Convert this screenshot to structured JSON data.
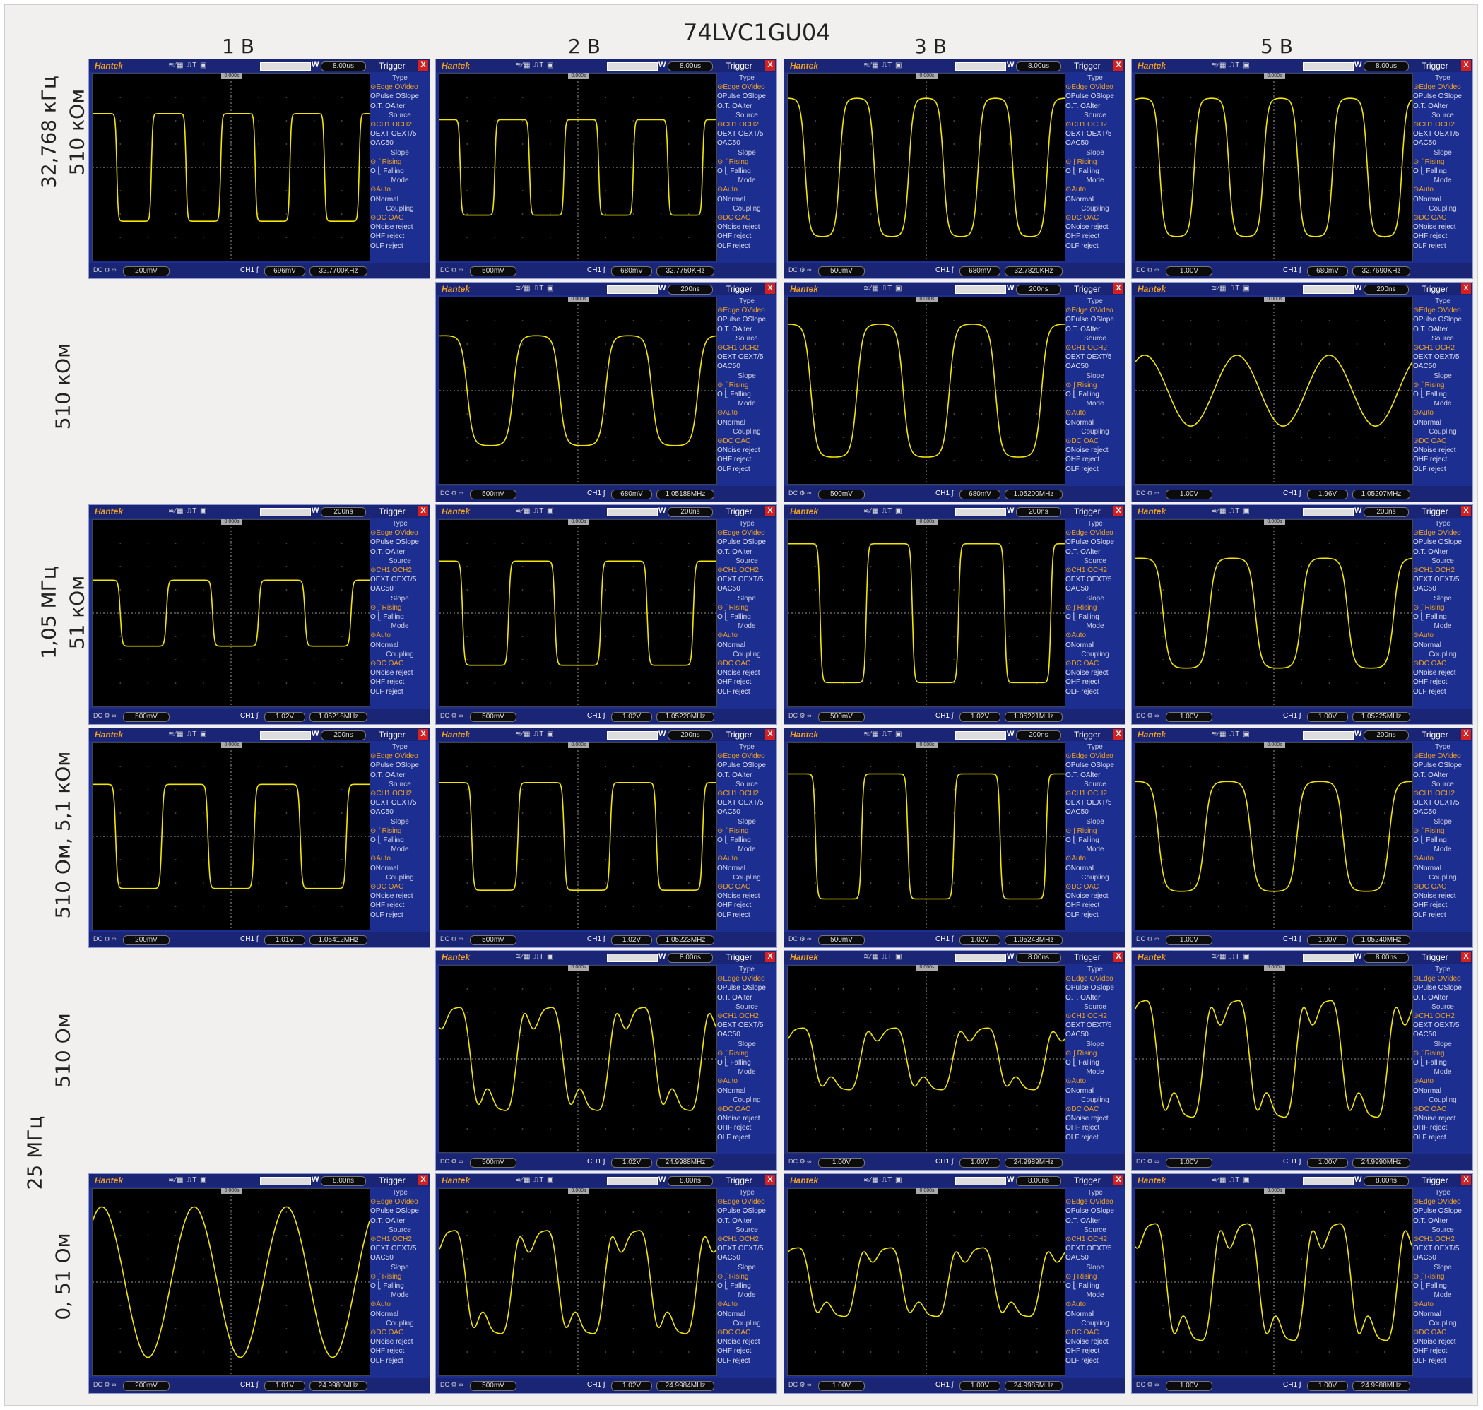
{
  "title": "74LVC1GU04",
  "columns": [
    "1 В",
    "2 В",
    "3 В",
    "5 В"
  ],
  "row_labels": [
    {
      "lines": [
        "32,768 кГц",
        "510 кОм"
      ]
    },
    {
      "lines": [
        "510 кОм"
      ]
    },
    {
      "lines": [
        "1,05 МГц",
        "51 кОм"
      ]
    },
    {
      "lines": [
        "510 Ом, 5,1 кОм"
      ]
    },
    {
      "lines": [
        "510 Ом"
      ]
    },
    {
      "lines": [
        "25 МГц"
      ]
    },
    {
      "lines": [
        "0,  51 Ом"
      ]
    }
  ],
  "scope_ui": {
    "brand": "Hantek",
    "trigger_title": "Trigger",
    "close": "X",
    "w": "W",
    "cursor": "0.000s",
    "ch1": "CH1",
    "icons": [
      "wave-icon",
      "pen-icon",
      "trigger-pulse-icon",
      "floppy-icon"
    ],
    "panel": [
      {
        "t": "Type",
        "hd": true
      },
      {
        "t": "⊙Edge  OVideo",
        "sel": true
      },
      {
        "t": "OPulse OSlope"
      },
      {
        "t": "O.T.   OAlter"
      },
      {
        "t": "Source",
        "hd": true
      },
      {
        "t": "⊙CH1   OCH2",
        "sel": true
      },
      {
        "t": "OEXT   OEXT/5"
      },
      {
        "t": "OAC50"
      },
      {
        "t": "Slope",
        "hd": true
      },
      {
        "t": "⊙ ∫ Rising",
        "sel": true
      },
      {
        "t": "O ⎣ Falling"
      },
      {
        "t": "Mode",
        "hd": true
      },
      {
        "t": "⊙Auto",
        "sel": true
      },
      {
        "t": "ONormal"
      },
      {
        "t": "Coupling",
        "hd": true
      },
      {
        "t": "⊙DC    OAC",
        "sel": true
      },
      {
        "t": "ONoise reject"
      },
      {
        "t": "OHF reject"
      },
      {
        "t": "OLF reject"
      }
    ]
  },
  "scopes": [
    {
      "row": 0,
      "col": 0,
      "timebase": "8.00us",
      "volts": "200mV",
      "trig": "696mV",
      "freq": "32.7700KHz",
      "shape": "square",
      "amp": 0.62,
      "cycles": 4
    },
    {
      "row": 0,
      "col": 1,
      "timebase": "8.00us",
      "volts": "500mV",
      "trig": "680mV",
      "freq": "32.7750KHz",
      "shape": "square",
      "amp": 0.55,
      "cycles": 4
    },
    {
      "row": 0,
      "col": 2,
      "timebase": "8.00us",
      "volts": "500mV",
      "trig": "680mV",
      "freq": "32.7820KHz",
      "shape": "rounded",
      "amp": 0.78,
      "cycles": 4
    },
    {
      "row": 0,
      "col": 3,
      "timebase": "8.00us",
      "volts": "1.00V",
      "trig": "680mV",
      "freq": "32.7690KHz",
      "shape": "rounded",
      "amp": 0.78,
      "cycles": 4
    },
    {
      "row": 1,
      "col": 1,
      "timebase": "200ns",
      "volts": "500mV",
      "trig": "680mV",
      "freq": "1.05188MHz",
      "shape": "rounded",
      "amp": 0.62,
      "cycles": 3
    },
    {
      "row": 1,
      "col": 2,
      "timebase": "200ns",
      "volts": "500mV",
      "trig": "680mV",
      "freq": "1.05200MHz",
      "shape": "rounded",
      "amp": 0.75,
      "cycles": 3
    },
    {
      "row": 1,
      "col": 3,
      "timebase": "200ns",
      "volts": "1.00V",
      "trig": "1.96V",
      "freq": "1.05207MHz",
      "shape": "sine",
      "amp": 0.4,
      "cycles": 3
    },
    {
      "row": 2,
      "col": 0,
      "timebase": "200ns",
      "volts": "500mV",
      "trig": "1.02V",
      "freq": "1.05216MHz",
      "shape": "square",
      "amp": 0.38,
      "cycles": 3
    },
    {
      "row": 2,
      "col": 1,
      "timebase": "200ns",
      "volts": "500mV",
      "trig": "1.02V",
      "freq": "1.05220MHz",
      "shape": "square",
      "amp": 0.6,
      "cycles": 3
    },
    {
      "row": 2,
      "col": 2,
      "timebase": "200ns",
      "volts": "500mV",
      "trig": "1.02V",
      "freq": "1.05221MHz",
      "shape": "square",
      "amp": 0.8,
      "cycles": 3
    },
    {
      "row": 2,
      "col": 3,
      "timebase": "200ns",
      "volts": "1.00V",
      "trig": "1.00V",
      "freq": "1.05225MHz",
      "shape": "rounded",
      "amp": 0.62,
      "cycles": 3
    },
    {
      "row": 3,
      "col": 0,
      "timebase": "200ns",
      "volts": "200mV",
      "trig": "1.01V",
      "freq": "1.05412MHz",
      "shape": "square",
      "amp": 0.6,
      "cycles": 3
    },
    {
      "row": 3,
      "col": 1,
      "timebase": "200ns",
      "volts": "500mV",
      "trig": "1.02V",
      "freq": "1.05223MHz",
      "shape": "square",
      "amp": 0.62,
      "cycles": 3
    },
    {
      "row": 3,
      "col": 2,
      "timebase": "200ns",
      "volts": "500mV",
      "trig": "1.02V",
      "freq": "1.05243MHz",
      "shape": "square",
      "amp": 0.72,
      "cycles": 3
    },
    {
      "row": 3,
      "col": 3,
      "timebase": "200ns",
      "volts": "1.00V",
      "trig": "1.00V",
      "freq": "1.05240MHz",
      "shape": "rounded",
      "amp": 0.62,
      "cycles": 3
    },
    {
      "row": 4,
      "col": 1,
      "timebase": "8.00ns",
      "volts": "500mV",
      "trig": "1.02V",
      "freq": "24.9988MHz",
      "shape": "harmonic",
      "amp": 0.75,
      "cycles": 3
    },
    {
      "row": 4,
      "col": 2,
      "timebase": "8.00ns",
      "volts": "1.00V",
      "trig": "1.00V",
      "freq": "24.9989MHz",
      "shape": "harmonic",
      "amp": 0.45,
      "cycles": 3
    },
    {
      "row": 4,
      "col": 3,
      "timebase": "8.00ns",
      "volts": "1.00V",
      "trig": "1.00V",
      "freq": "24.9990MHz",
      "shape": "harmonic",
      "amp": 0.85,
      "cycles": 3
    },
    {
      "row": 5,
      "col": 0,
      "timebase": "8.00ns",
      "volts": "200mV",
      "trig": "1.01V",
      "freq": "24.9980MHz",
      "shape": "sine",
      "amp": 0.85,
      "cycles": 3
    },
    {
      "row": 5,
      "col": 1,
      "timebase": "8.00ns",
      "volts": "500mV",
      "trig": "1.02V",
      "freq": "24.9984MHz",
      "shape": "harmonic",
      "amp": 0.75,
      "cycles": 3
    },
    {
      "row": 5,
      "col": 2,
      "timebase": "8.00ns",
      "volts": "1.00V",
      "trig": "1.00V",
      "freq": "24.9985MHz",
      "shape": "harmonic",
      "amp": 0.5,
      "cycles": 3
    },
    {
      "row": 5,
      "col": 3,
      "timebase": "8.00ns",
      "volts": "1.00V",
      "trig": "1.00V",
      "freq": "24.9988MHz",
      "shape": "harmonic",
      "amp": 0.85,
      "cycles": 3
    }
  ],
  "colors": {
    "trace": "#f2e600",
    "grid": "#555555",
    "panel": "#1c2f90",
    "accent": "#f0a020"
  }
}
